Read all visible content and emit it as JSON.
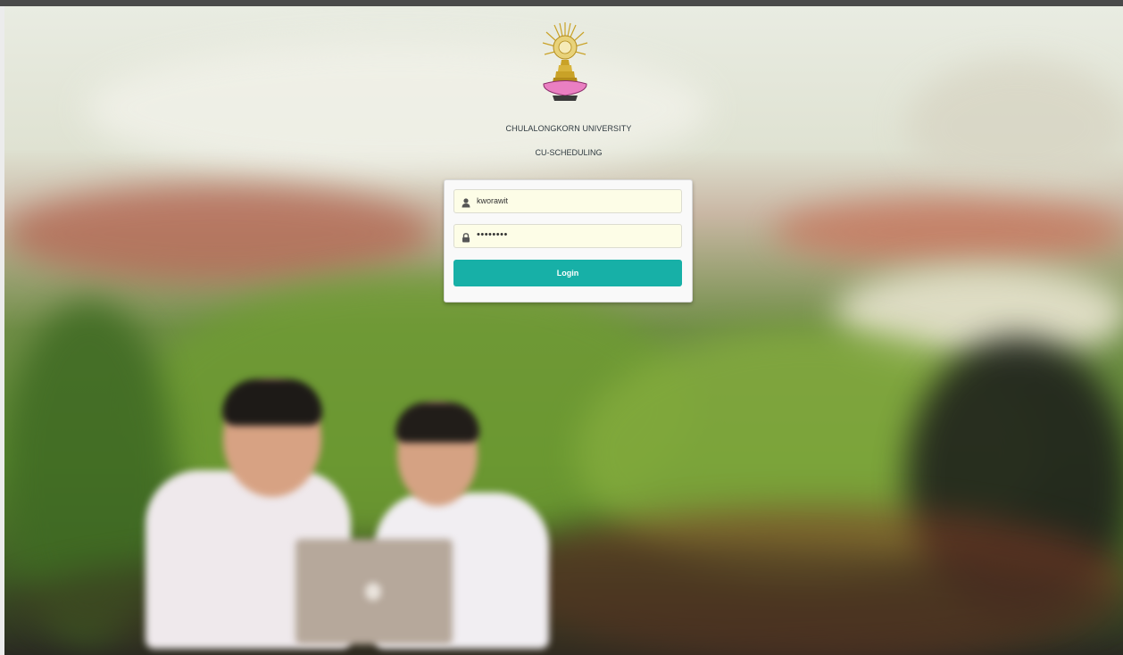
{
  "header": {
    "university_name": "CHULALONGKORN UNIVERSITY",
    "app_name": "CU-SCHEDULING",
    "logo_icon": "chulalongkorn-emblem-icon"
  },
  "login_form": {
    "username": {
      "icon": "user-icon",
      "value": "kworawit"
    },
    "password": {
      "icon": "lock-icon",
      "masked_value": "••••••••"
    },
    "login_button_label": "Login"
  },
  "colors": {
    "accent": "#17b0a7",
    "input_background": "#fdfde7",
    "text": "#2f3a40"
  }
}
